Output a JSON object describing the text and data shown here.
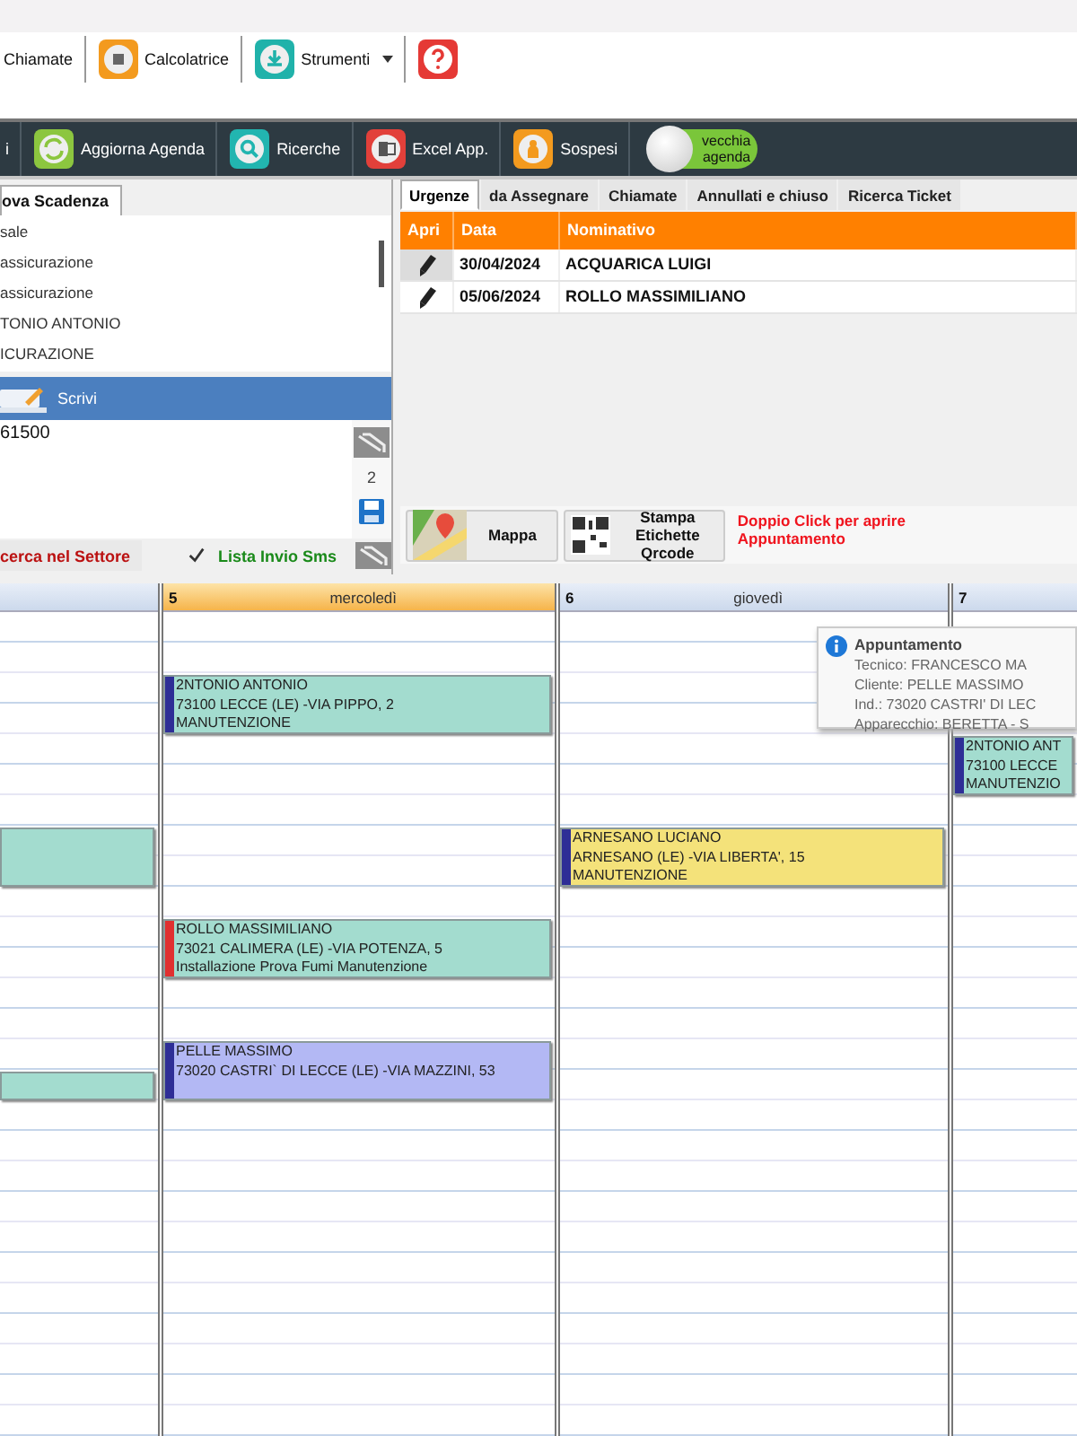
{
  "top_toolbar": {
    "items": [
      {
        "kind": "text",
        "label": "Chiamate"
      },
      {
        "kind": "calculator",
        "label": "Calcolatrice"
      },
      {
        "kind": "download",
        "label": "Strumenti",
        "dropdown": true
      },
      {
        "kind": "help"
      }
    ]
  },
  "agenda_toolbar": {
    "items": [
      {
        "kind": "text",
        "label": "i"
      },
      {
        "kind": "refresh",
        "label": "Aggiorna Agenda"
      },
      {
        "kind": "search",
        "label": "Ricerche"
      },
      {
        "kind": "excel",
        "label": "Excel App."
      },
      {
        "kind": "person",
        "label": "Sospesi"
      }
    ],
    "toggle": {
      "label": "vecchia agenda"
    }
  },
  "reminders": {
    "tab": "ova Scadenza",
    "items": [
      "sale",
      "assicurazione",
      "assicurazione",
      "TONIO ANTONIO",
      "ICURAZIONE"
    ],
    "compose": {
      "title": "Scrivi",
      "text": "61500",
      "count": "2"
    },
    "search_button": "cerca nel Settore",
    "sms_list": {
      "label": "Lista Invio Sms",
      "checked": true
    }
  },
  "tickets": {
    "tabs": [
      {
        "label": "Urgenze",
        "selected": true
      },
      {
        "label": "da Assegnare",
        "selected": false
      },
      {
        "label": "Chiamate",
        "selected": false
      },
      {
        "label": "Annullati e chiuso",
        "selected": false
      },
      {
        "label": "Ricerca Ticket",
        "selected": false
      }
    ],
    "columns": [
      "Apri",
      "Data",
      "Nominativo"
    ],
    "rows": [
      {
        "date": "30/04/2024",
        "name": "ACQUARICA LUIGI",
        "selected": true
      },
      {
        "date": "05/06/2024",
        "name": "ROLLO MASSIMILIANO",
        "selected": false
      }
    ],
    "map_button": "Mappa",
    "qr_button": "Stampa Etichette Qrcode",
    "hint": "Doppio Click per aprire Appuntamento"
  },
  "calendar": {
    "days": [
      {
        "selected": false,
        "appointments": [
          {
            "color": "#a3dccf"
          },
          {
            "color": "#a3dccf"
          }
        ]
      },
      {
        "number": "5",
        "name": "mercoledì",
        "selected": true,
        "appointments": [
          {
            "color": "#a3dccf",
            "marker": {
              "color": "#2e2e96"
            },
            "lines": [
              "2NTONIO ANTONIO",
              "73100 LECCE (LE) -VIA PIPPO, 2",
              "MANUTENZIONE"
            ]
          },
          {
            "color": "#a3dccf",
            "marker": {
              "color": "#e03030"
            },
            "lines": [
              "ROLLO MASSIMILIANO",
              "73021 CALIMERA (LE) -VIA POTENZA, 5",
              "Installazione Prova Fumi Manutenzione"
            ]
          },
          {
            "color": "#b3b8f4",
            "marker": {
              "color": "#2e2e96"
            },
            "lines": [
              "PELLE MASSIMO",
              "73020 CASTRI` DI LECCE (LE) -VIA MAZZINI, 53"
            ]
          }
        ]
      },
      {
        "number": "6",
        "name": "giovedì",
        "selected": false,
        "appointments": [
          {
            "color": "#f4e27a",
            "marker": {
              "color": "#2e2e96"
            },
            "lines": [
              "ARNESANO LUCIANO",
              "ARNESANO (LE) -VIA LIBERTA', 15",
              "MANUTENZIONE"
            ]
          }
        ]
      },
      {
        "number": "7",
        "selected": false,
        "appointments": [
          {
            "color": "#a3dccf",
            "marker": {
              "color": "#2e2e96"
            },
            "lines": [
              "2NTONIO ANT",
              "73100 LECCE",
              "MANUTENZIO"
            ]
          }
        ]
      }
    ],
    "tooltip": {
      "title": "Appuntamento",
      "lines": [
        "Tecnico: FRANCESCO MA",
        "Cliente: PELLE MASSIMO",
        "Ind.: 73020 CASTRI' DI LEC",
        "Apparecchio: BERETTA - S"
      ]
    }
  }
}
